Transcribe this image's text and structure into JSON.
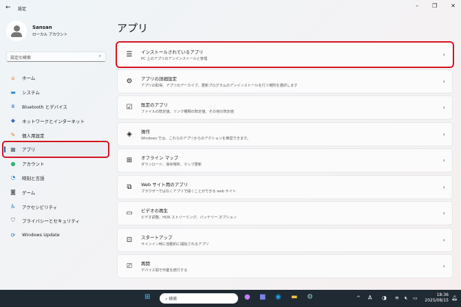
{
  "window": {
    "title": "設定",
    "back_icon": "arrow-left-icon"
  },
  "user": {
    "name": "Sansan",
    "account_type": "ローカル アカウント"
  },
  "search": {
    "placeholder": "設定の検索"
  },
  "sidebar": {
    "items": [
      {
        "label": "ホーム",
        "icon": "home-icon",
        "color": "#e8773a"
      },
      {
        "label": "システム",
        "icon": "monitor-icon",
        "color": "#2a8ad4"
      },
      {
        "label": "Bluetooth とデバイス",
        "icon": "bluetooth-icon",
        "color": "#1e6fc9"
      },
      {
        "label": "ネットワークとインターネット",
        "icon": "network-icon",
        "color": "#3b6fb5"
      },
      {
        "label": "個人用設定",
        "icon": "brush-icon",
        "color": "#d47a2a"
      },
      {
        "label": "アプリ",
        "icon": "apps-icon",
        "color": "#4a5a70",
        "active": true
      },
      {
        "label": "アカウント",
        "icon": "person-icon",
        "color": "#2bb673"
      },
      {
        "label": "時刻と言語",
        "icon": "globe-clock-icon",
        "color": "#2a8ad4"
      },
      {
        "label": "ゲーム",
        "icon": "gamepad-icon",
        "color": "#666"
      },
      {
        "label": "アクセシビリティ",
        "icon": "accessibility-icon",
        "color": "#1e6fc9"
      },
      {
        "label": "プライバシーとセキュリティ",
        "icon": "shield-icon",
        "color": "#6d7a88"
      },
      {
        "label": "Windows Update",
        "icon": "update-icon",
        "color": "#1e6fc9"
      }
    ]
  },
  "main": {
    "title": "アプリ",
    "cards": [
      {
        "title": "インストールされているアプリ",
        "subtitle": "PC 上のアプリのアンインストールと管理",
        "icon": "list-icon",
        "glyph": "☰",
        "highlighted": true
      },
      {
        "title": "アプリの詳細設定",
        "subtitle": "アプリの取得、アプリのアーカイブ、更新プログラムのアンインストールを行う場所を選択します",
        "icon": "app-settings-icon",
        "glyph": "⚙"
      },
      {
        "title": "既定のアプリ",
        "subtitle": "ファイルの既定値、リンク種類の既定値、その他の既定値",
        "icon": "default-apps-icon",
        "glyph": "☑"
      },
      {
        "title": "操作",
        "subtitle": "Windows では、これらのアプリからのアクションを推奨できます。",
        "icon": "actions-icon",
        "glyph": "◈"
      },
      {
        "title": "オフライン マップ",
        "subtitle": "ダウンロード、保存場所、マップ更新",
        "icon": "map-icon",
        "glyph": "⊞"
      },
      {
        "title": "Web サイト用のアプリ",
        "subtitle": "ブラウザーではなくアプリで開くことができる web サイト",
        "icon": "open-external-icon",
        "glyph": "⧉"
      },
      {
        "title": "ビデオの再生",
        "subtitle": "ビデオ調整、HDR ストリーミング、バッテリー オプション",
        "icon": "video-icon",
        "glyph": "▭"
      },
      {
        "title": "スタートアップ",
        "subtitle": "サインイン時に自動的に開始されるアプリ",
        "icon": "startup-icon",
        "glyph": "⊡"
      },
      {
        "title": "再開",
        "subtitle": "デバイス間で作業を続行する",
        "icon": "resume-icon",
        "glyph": "⎚"
      }
    ]
  },
  "taskbar": {
    "search_placeholder": "検索",
    "time": "18:36",
    "date": "2025/08/15",
    "ime": "A"
  }
}
